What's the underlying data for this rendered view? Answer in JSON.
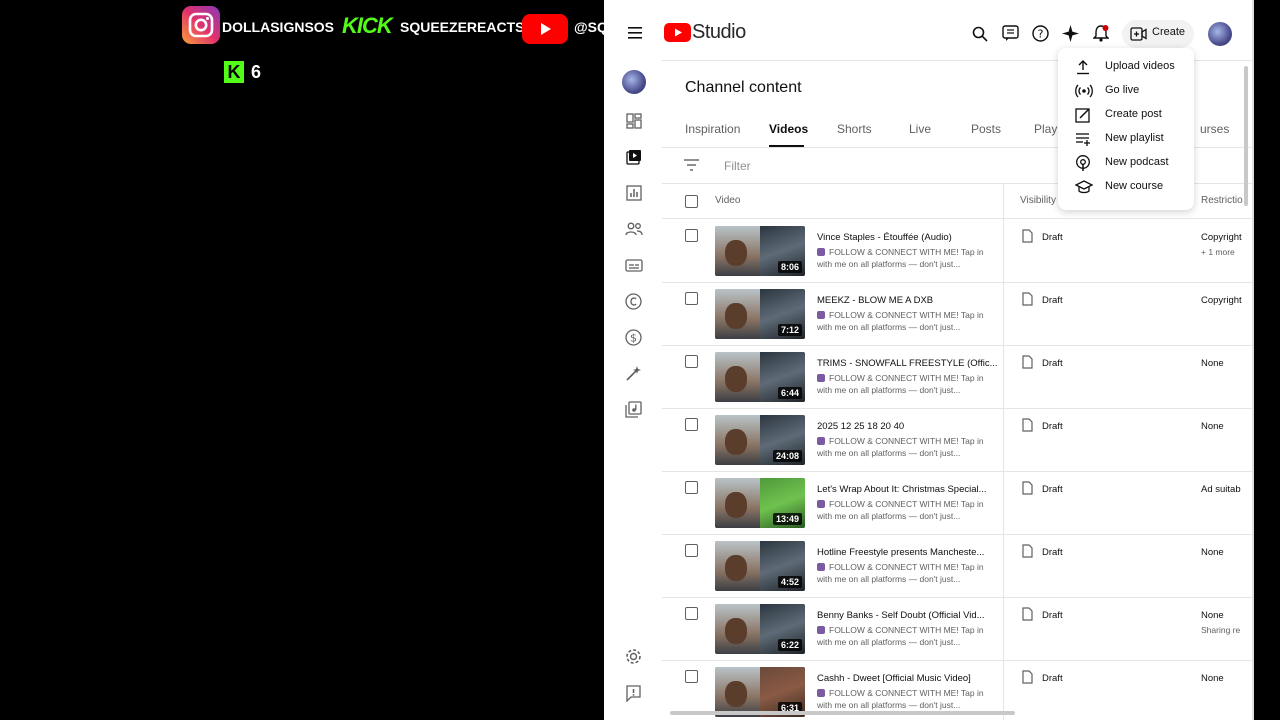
{
  "overlay": {
    "instagram_handle": "DOLLASIGNSOS",
    "kick_handle": "SQUEEZEREACTS",
    "youtube_handle": "@SQ",
    "kick_brand": "KICK",
    "kick_viewer_count": "6"
  },
  "studio": {
    "logo_text": "Studio",
    "create_label": "Create",
    "page_title": "Channel content",
    "tabs": [
      "Inspiration",
      "Videos",
      "Shorts",
      "Live",
      "Posts",
      "Playl",
      "urses"
    ],
    "active_tab": "Videos",
    "filter_placeholder": "Filter",
    "columns": {
      "video": "Video",
      "visibility": "Visibility",
      "restrictions": "Restrictio"
    },
    "create_menu": [
      {
        "label": "Upload videos",
        "icon": "upload-icon"
      },
      {
        "label": "Go live",
        "icon": "live-broadcast-icon"
      },
      {
        "label": "Create post",
        "icon": "edit-post-icon"
      },
      {
        "label": "New playlist",
        "icon": "playlist-add-icon"
      },
      {
        "label": "New podcast",
        "icon": "podcast-icon"
      },
      {
        "label": "New course",
        "icon": "course-icon"
      }
    ],
    "videos": [
      {
        "title": "Vince Staples - Étouffée (Audio)",
        "desc": "FOLLOW & CONNECT WITH ME! Tap in with me on all platforms — don't just...",
        "duration": "8:06",
        "visibility": "Draft",
        "restriction": "Copyright",
        "restriction_extra": "+ 1 more"
      },
      {
        "title": "MEEKZ - BLOW ME A DXB",
        "desc": "FOLLOW & CONNECT WITH ME! Tap in with me on all platforms — don't just...",
        "duration": "7:12",
        "visibility": "Draft",
        "restriction": "Copyright",
        "restriction_extra": ""
      },
      {
        "title": "TRIMS - SNOWFALL FREESTYLE (Offic...",
        "desc": "FOLLOW & CONNECT WITH ME! Tap in with me on all platforms — don't just...",
        "duration": "6:44",
        "visibility": "Draft",
        "restriction": "None",
        "restriction_extra": ""
      },
      {
        "title": "2025 12 25 18 20 40",
        "desc": "FOLLOW & CONNECT WITH ME! Tap in with me on all platforms — don't just...",
        "duration": "24:08",
        "visibility": "Draft",
        "restriction": "None",
        "restriction_extra": ""
      },
      {
        "title": "Let's Wrap About It: Christmas Special...",
        "desc": "FOLLOW & CONNECT WITH ME! Tap in with me on all platforms — don't just...",
        "duration": "13:49",
        "visibility": "Draft",
        "restriction": "Ad suitab",
        "restriction_extra": ""
      },
      {
        "title": "Hotline Freestyle presents Mancheste...",
        "desc": "FOLLOW & CONNECT WITH ME! Tap in with me on all platforms — don't just...",
        "duration": "4:52",
        "visibility": "Draft",
        "restriction": "None",
        "restriction_extra": ""
      },
      {
        "title": "Benny Banks - Self Doubt (Official Vid...",
        "desc": "FOLLOW & CONNECT WITH ME! Tap in with me on all platforms — don't just...",
        "duration": "6:22",
        "visibility": "Draft",
        "restriction": "None",
        "restriction_extra": "Sharing re"
      },
      {
        "title": "Cashh - Dweet [Official Music Video]",
        "desc": "FOLLOW & CONNECT WITH ME! Tap in with me on all platforms — don't just...",
        "duration": "6:31",
        "visibility": "Draft",
        "restriction": "None",
        "restriction_extra": ""
      }
    ],
    "sidebar_icons": [
      "dashboard-icon",
      "content-icon",
      "analytics-icon",
      "community-icon",
      "subtitles-icon",
      "copyright-icon",
      "earn-icon",
      "customization-icon",
      "audio-library-icon",
      "settings-icon",
      "feedback-icon"
    ]
  },
  "colors": {
    "youtube_red": "#ff0000",
    "kick_green": "#53fc18",
    "accent": "#0f0f0f"
  }
}
